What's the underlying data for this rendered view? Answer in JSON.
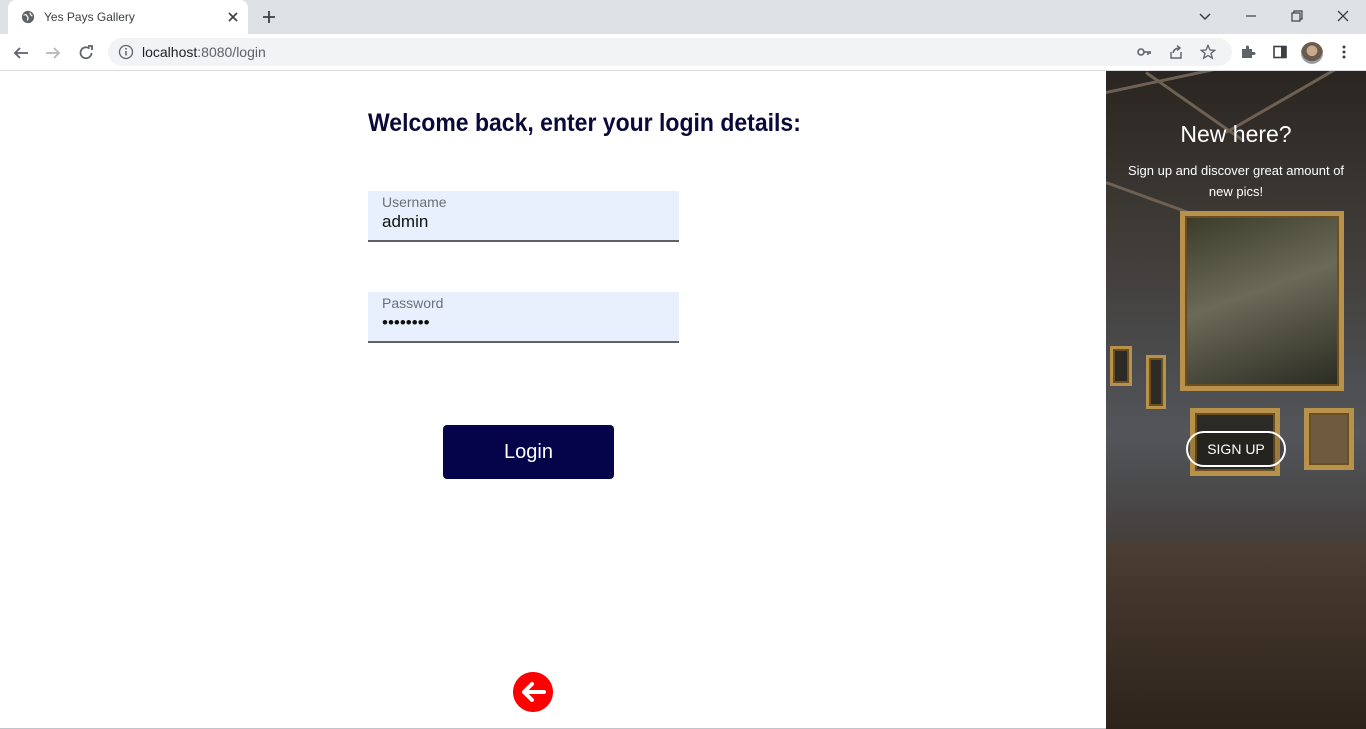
{
  "browser": {
    "tab_title": "Yes Pays Gallery",
    "url_host": "localhost",
    "url_path": ":8080/login"
  },
  "login": {
    "heading": "Welcome back, enter your login details:",
    "username_label": "Username",
    "username_value": "admin",
    "password_label": "Password",
    "password_value": "password",
    "login_button": "Login"
  },
  "side": {
    "title": "New here?",
    "text": "Sign up and discover great amount of new pics!",
    "signup_button": "SIGN UP"
  },
  "colors": {
    "heading": "#0a0a3a",
    "login_button_bg": "#05034a",
    "field_bg": "#e8f0fe",
    "back_button_bg": "#ff0000"
  }
}
